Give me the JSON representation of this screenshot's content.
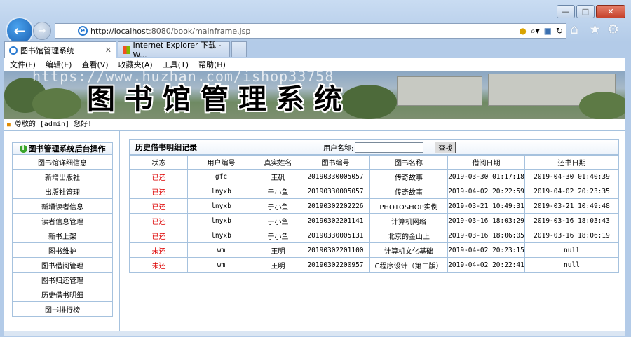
{
  "browser": {
    "url_host": "http://localhost",
    "url_rest": ":8080/book/mainframe.jsp",
    "tabs": [
      {
        "label": "图书馆管理系统",
        "active": true
      },
      {
        "label": "Internet Explorer 下载 - W...",
        "active": false
      }
    ],
    "menu": [
      "文件(F)",
      "编辑(E)",
      "查看(V)",
      "收藏夹(A)",
      "工具(T)",
      "帮助(H)"
    ]
  },
  "banner": {
    "title": "图书馆管理系统",
    "watermark": "https://www.huzhan.com/ishop33758"
  },
  "greeting": "尊敬的 [admin] 您好!",
  "sidebar": {
    "header": "图书管理系统后台操作",
    "items": [
      "图书馆详细信息",
      "新增出版社",
      "出版社管理",
      "新增读者信息",
      "读者信息管理",
      "新书上架",
      "图书维护",
      "图书借阅管理",
      "图书归还管理",
      "历史借书明细",
      "图书排行榜"
    ]
  },
  "main": {
    "title": "历史借书明细记录",
    "user_label": "用户名称:",
    "user_value": "",
    "search_label": "查找",
    "columns": [
      "状态",
      "用户编号",
      "真实姓名",
      "图书编号",
      "图书名称",
      "借阅日期",
      "还书日期"
    ],
    "rows": [
      [
        "已还",
        "gfc",
        "王矾",
        "20190330005057",
        "传奇故事",
        "2019-03-30 01:17:18",
        "2019-04-30 01:40:39"
      ],
      [
        "已还",
        "lnyxb",
        "于小鱼",
        "20190330005057",
        "传奇故事",
        "2019-04-02 20:22:59",
        "2019-04-02 20:23:35"
      ],
      [
        "已还",
        "lnyxb",
        "于小鱼",
        "20190302202226",
        "PHOTOSHOP实例",
        "2019-03-21 10:49:31",
        "2019-03-21 10:49:48"
      ],
      [
        "已还",
        "lnyxb",
        "于小鱼",
        "20190302201141",
        "计算机网络",
        "2019-03-16 18:03:29",
        "2019-03-16 18:03:43"
      ],
      [
        "已还",
        "lnyxb",
        "于小鱼",
        "20190330005131",
        "北京的金山上",
        "2019-03-16 18:06:05",
        "2019-03-16 18:06:19"
      ],
      [
        "未还",
        "wm",
        "王明",
        "20190302201100",
        "计算机文化基础",
        "2019-04-02 20:23:15",
        "null"
      ],
      [
        "未还",
        "wm",
        "王明",
        "20190302200957",
        "C程序设计（第二版）",
        "2019-04-02 20:22:41",
        "null"
      ]
    ]
  },
  "colors": {
    "accent": "#1a5fb0",
    "border": "#a6c2de",
    "status": "#dd0000"
  }
}
